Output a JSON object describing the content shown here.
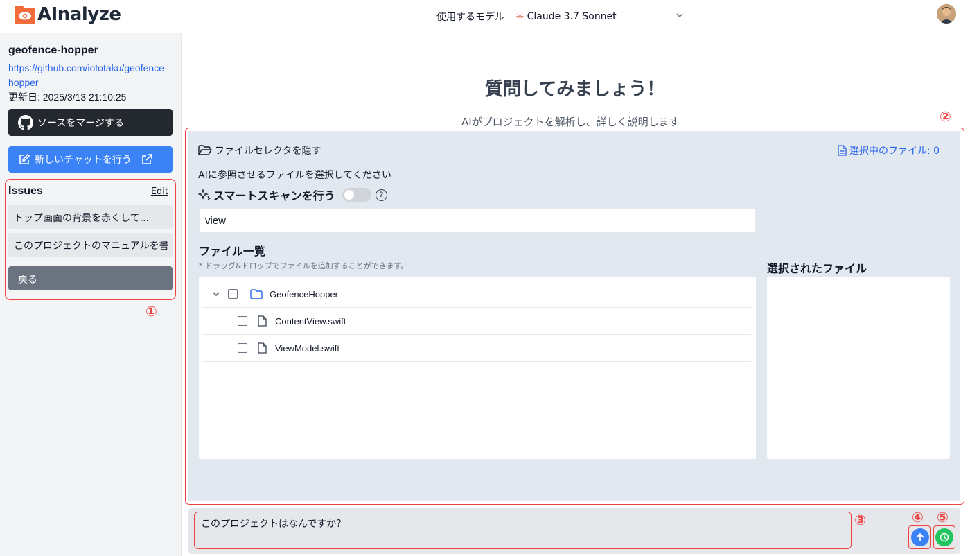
{
  "app": {
    "name": "AInalyze",
    "brand_color": "#f26b3a"
  },
  "header": {
    "model_label": "使用するモデル",
    "model_value": "Claude 3.7 Sonnet"
  },
  "sidebar": {
    "project_name": "geofence-hopper",
    "project_url": "https://github.com/iototaku/geofence-hopper",
    "updated": "更新日: 2025/3/13 21:10:25",
    "merge_button": "ソースをマージする",
    "new_chat_button": "新しいチャットを行う",
    "issues": {
      "title": "Issues",
      "edit": "Edit",
      "items": [
        "トップ画面の背景を赤くして...",
        "このプロジェクトのマニュアルを書"
      ],
      "back": "戻る"
    }
  },
  "annotations": [
    "①",
    "②",
    "③",
    "④",
    "⑤"
  ],
  "main": {
    "title": "質問してみましょう！",
    "subtitle": "AIがプロジェクトを解析し、詳しく説明します"
  },
  "selector": {
    "toggle_label": "ファイルセレクタを隠す",
    "selected_count": "選択中のファイル: 0",
    "instruction": "AIに参照させるファイルを選択してください",
    "smart_scan": "スマートスキャンを行う",
    "help": "?",
    "search_value": "view",
    "files_title": "ファイル一覧",
    "files_note": "* ドラッグ&ドロップでファイルを追加することができます。",
    "selected_title": "選択されたファイル",
    "tree": {
      "folder": "GeofenceHopper",
      "files": [
        "ContentView.swift",
        "ViewModel.swift"
      ]
    }
  },
  "chat": {
    "input_value": "このプロジェクトはなんですか？"
  }
}
